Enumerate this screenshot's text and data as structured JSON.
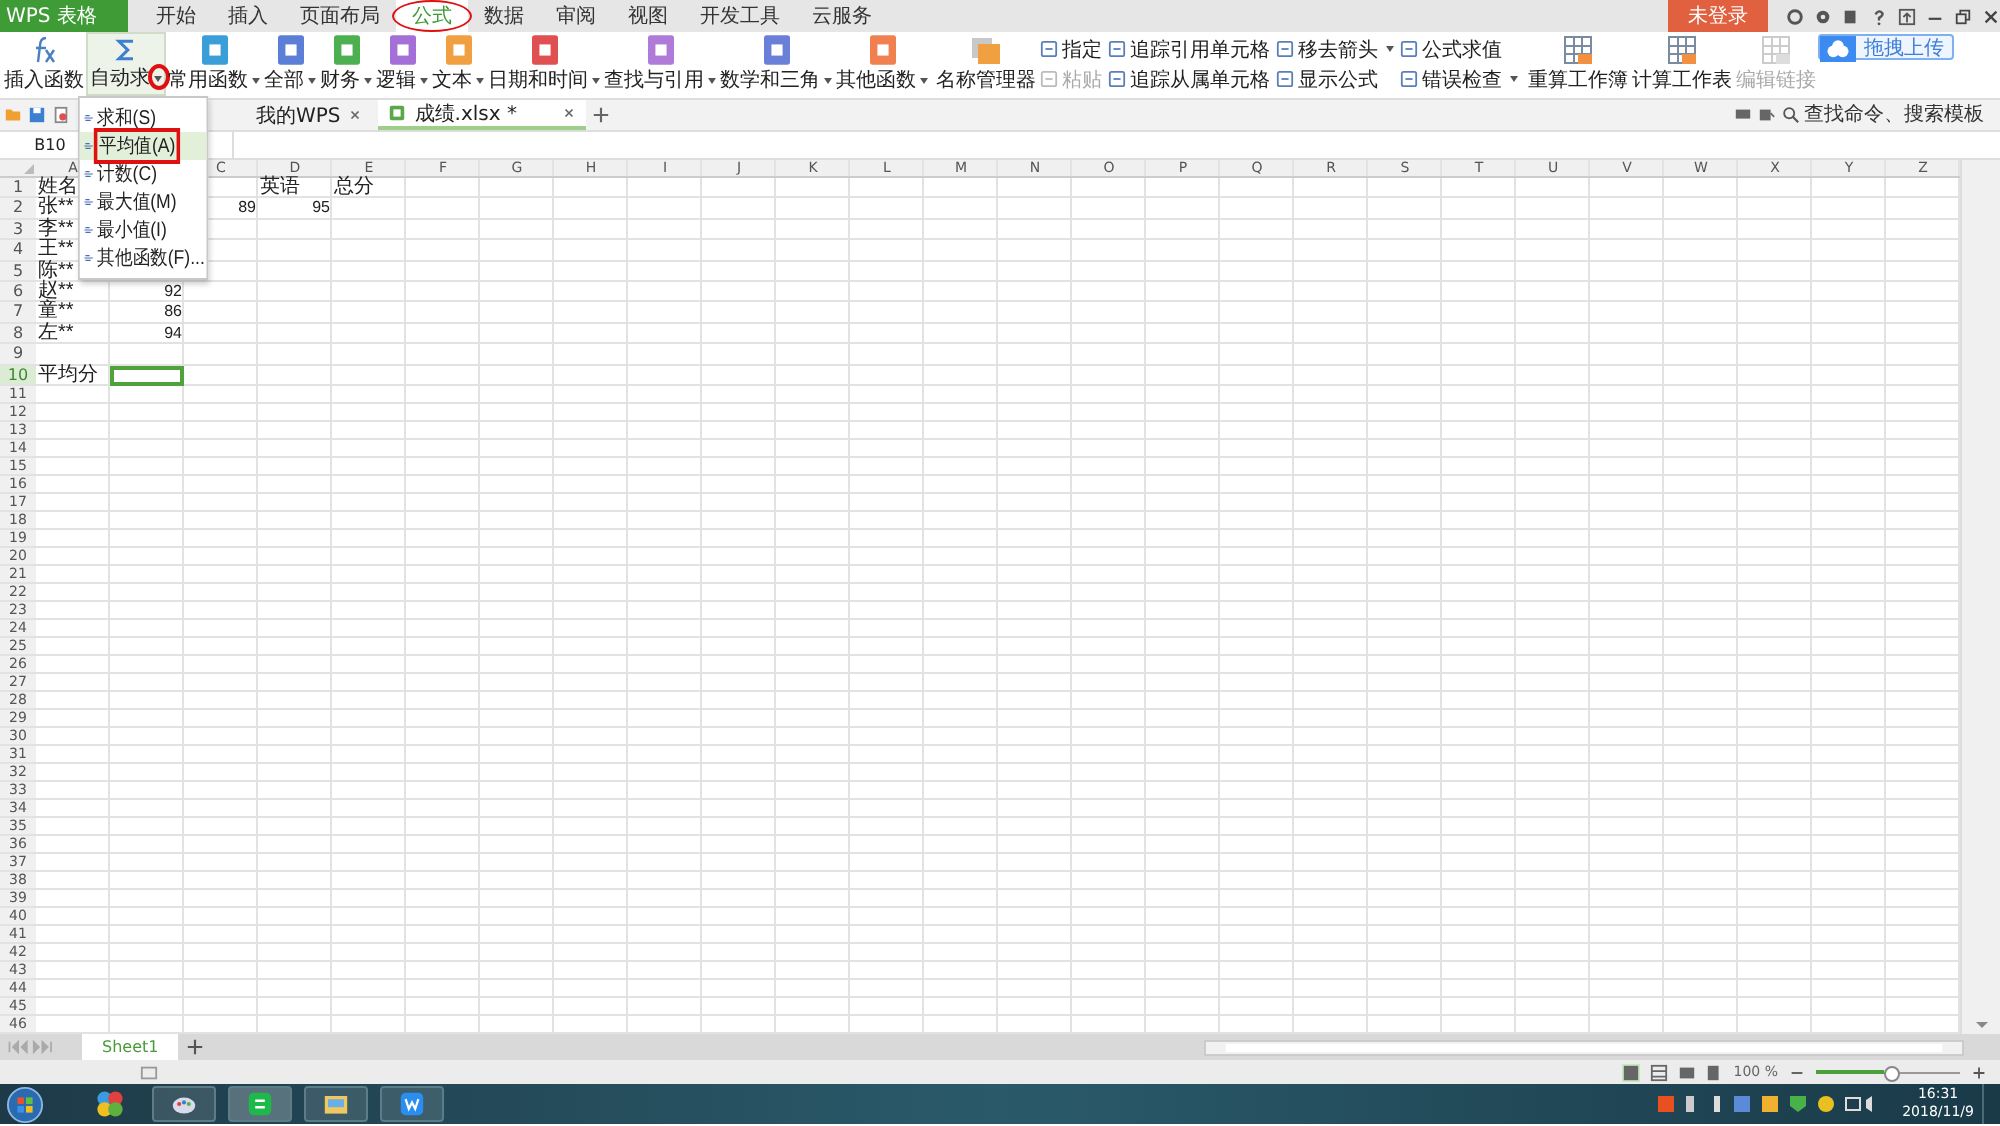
{
  "app_button": {
    "label": "WPS 表格"
  },
  "tabs": [
    {
      "label": "开始",
      "selected": false,
      "circled": false
    },
    {
      "label": "插入",
      "selected": false,
      "circled": false
    },
    {
      "label": "页面布局",
      "selected": false,
      "circled": false
    },
    {
      "label": "公式",
      "selected": true,
      "circled": true
    },
    {
      "label": "数据",
      "selected": false,
      "circled": false
    },
    {
      "label": "审阅",
      "selected": false,
      "circled": false
    },
    {
      "label": "视图",
      "selected": false,
      "circled": false
    },
    {
      "label": "开发工具",
      "selected": false,
      "circled": false
    },
    {
      "label": "云服务",
      "selected": false,
      "circled": false
    }
  ],
  "account": {
    "label": "未登录"
  },
  "upload_button": {
    "label": "拖拽上传"
  },
  "ribbon": {
    "insert_function": {
      "label": "插入函数"
    },
    "autosum": {
      "label": "自动求",
      "circled": true
    },
    "categories": [
      {
        "label": "常用函数",
        "color": "#3a9fd8"
      },
      {
        "label": "全部",
        "color": "#5b7fd6"
      },
      {
        "label": "财务",
        "color": "#4caf50"
      },
      {
        "label": "逻辑",
        "color": "#a46fd6"
      },
      {
        "label": "文本",
        "color": "#f0a040"
      },
      {
        "label": "日期和时间",
        "color": "#e05050"
      },
      {
        "label": "查找与引用",
        "color": "#b07ad8"
      },
      {
        "label": "数学和三角",
        "color": "#6a7fd8"
      },
      {
        "label": "其他函数",
        "color": "#f08050"
      }
    ],
    "name_manager": {
      "label": "名称管理器"
    },
    "small_groups": [
      [
        {
          "label": "指定",
          "disabled": false,
          "dropdown": false
        },
        {
          "label": "粘贴",
          "disabled": true,
          "dropdown": false
        }
      ],
      [
        {
          "label": "追踪引用单元格",
          "disabled": false,
          "dropdown": false
        },
        {
          "label": "追踪从属单元格",
          "disabled": false,
          "dropdown": false
        }
      ],
      [
        {
          "label": "移去箭头",
          "disabled": false,
          "dropdown": true
        },
        {
          "label": "显示公式",
          "disabled": false,
          "dropdown": false
        }
      ],
      [
        {
          "label": "公式求值",
          "disabled": false,
          "dropdown": false
        },
        {
          "label": "错误检查",
          "disabled": false,
          "dropdown": true
        }
      ]
    ],
    "calc": [
      {
        "label": "重算工作簿",
        "disabled": false
      },
      {
        "label": "计算工作表",
        "disabled": false
      },
      {
        "label": "编辑链接",
        "disabled": true
      }
    ]
  },
  "autosum_menu": [
    {
      "label": "求和(S)",
      "selected": false,
      "boxed": false
    },
    {
      "label": "平均值(A)",
      "selected": true,
      "boxed": true
    },
    {
      "label": "计数(C)",
      "selected": false,
      "boxed": false
    },
    {
      "label": "最大值(M)",
      "selected": false,
      "boxed": false
    },
    {
      "label": "最小值(I)",
      "selected": false,
      "boxed": false
    },
    {
      "label": "其他函数(F)...",
      "selected": false,
      "boxed": false
    }
  ],
  "doc_tabs": [
    {
      "label": "我的WPS",
      "selected": false
    },
    {
      "label": "成绩.xlsx *",
      "selected": true
    }
  ],
  "search": {
    "placeholder": "查找命令、搜索模板"
  },
  "formula_bar": {
    "name_box": "B10"
  },
  "sheet": {
    "columns": [
      "A",
      null,
      "C",
      "D",
      "E",
      "F",
      "G",
      "H",
      "I",
      "J",
      "K",
      "L",
      "M",
      "N",
      "O",
      "P",
      "Q",
      "R",
      "S",
      "T",
      "U",
      "V",
      "W",
      "X",
      "Y",
      "Z"
    ],
    "rows": [
      {
        "number": "1",
        "cells": [
          {
            "text": "姓名",
            "kind": "text",
            "selected": false
          },
          null,
          null,
          {
            "text": "英语",
            "kind": "text",
            "selected": false
          },
          {
            "text": "总分",
            "kind": "text",
            "selected": false
          }
        ]
      },
      {
        "number": "2",
        "cells": [
          {
            "text": "张**",
            "kind": "text",
            "selected": false
          },
          null,
          {
            "text": "89",
            "kind": "number",
            "selected": false
          },
          {
            "text": "95",
            "kind": "number",
            "selected": false
          }
        ]
      },
      {
        "number": "3",
        "cells": [
          {
            "text": "李**",
            "kind": "text",
            "selected": false
          }
        ]
      },
      {
        "number": "4",
        "cells": [
          {
            "text": "王**",
            "kind": "text",
            "selected": false
          }
        ]
      },
      {
        "number": "5",
        "cells": [
          {
            "text": "陈**",
            "kind": "text",
            "selected": false
          }
        ]
      },
      {
        "number": "6",
        "cells": [
          {
            "text": "赵**",
            "kind": "text",
            "selected": false
          },
          {
            "text": "92",
            "kind": "number",
            "selected": false
          }
        ]
      },
      {
        "number": "7",
        "cells": [
          {
            "text": "童**",
            "kind": "text",
            "selected": false
          },
          {
            "text": "86",
            "kind": "number",
            "selected": false
          }
        ]
      },
      {
        "number": "8",
        "cells": [
          {
            "text": "左**",
            "kind": "text",
            "selected": false
          },
          {
            "text": "94",
            "kind": "number",
            "selected": false
          }
        ]
      },
      {
        "number": "9"
      },
      {
        "number": "10",
        "cells": [
          {
            "text": "平均分",
            "kind": "text",
            "selected": false
          },
          {
            "selected": true
          }
        ]
      },
      {
        "number": "11"
      },
      {
        "number": "12"
      },
      {
        "number": "13"
      },
      {
        "number": "14"
      },
      {
        "number": "15"
      },
      {
        "number": "16"
      },
      {
        "number": "17"
      },
      {
        "number": "18"
      },
      {
        "number": "19"
      },
      {
        "number": "20"
      },
      {
        "number": "21"
      },
      {
        "number": "22"
      },
      {
        "number": "23"
      },
      {
        "number": "24"
      },
      {
        "number": "25"
      },
      {
        "number": "26"
      },
      {
        "number": "27"
      },
      {
        "number": "28"
      },
      {
        "number": "29"
      },
      {
        "number": "30"
      },
      {
        "number": "31"
      },
      {
        "number": "32"
      },
      {
        "number": "33"
      },
      {
        "number": "34"
      },
      {
        "number": "35"
      },
      {
        "number": "36"
      },
      {
        "number": "37"
      },
      {
        "number": "38"
      },
      {
        "number": "39"
      },
      {
        "number": "40"
      },
      {
        "number": "41"
      },
      {
        "number": "42"
      },
      {
        "number": "43"
      },
      {
        "number": "44"
      },
      {
        "number": "45"
      },
      {
        "number": "46"
      }
    ]
  },
  "sheet_tabs": [
    {
      "label": "Sheet1",
      "selected": true
    }
  ],
  "status_bar": {
    "zoom": {
      "label": "100 %",
      "level": 0.47
    }
  },
  "taskbar": {
    "time": "16:31",
    "date": "2018/11/9"
  }
}
